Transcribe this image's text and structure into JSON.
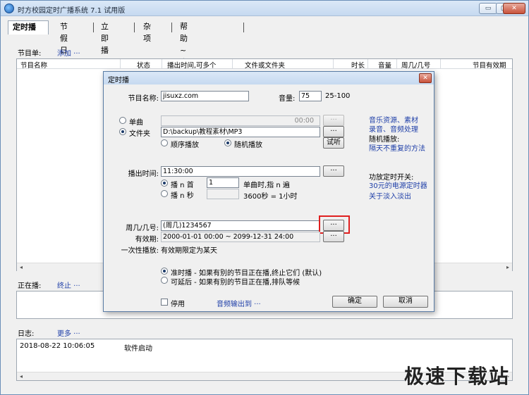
{
  "window": {
    "title": "时方校园定时广播系统 7.1 试用版",
    "controls": {
      "minimize": "▭",
      "maximize": "▢",
      "close": "✕"
    }
  },
  "tabs": [
    "定时播",
    "节假日",
    "立即播",
    "杂项",
    "帮助~咨询专家"
  ],
  "program_list": {
    "label": "节目单:",
    "add_link": "添加 ···",
    "columns": [
      "节目名称",
      "状态",
      "播出时间,可多个",
      "文件或文件夹",
      "时长",
      "音量",
      "周几/几号",
      "节目有效期"
    ]
  },
  "now_playing": {
    "label": "正在播:",
    "stop_link": "终止 ···"
  },
  "log": {
    "label": "日志:",
    "more_link": "更多 ···",
    "rows": [
      {
        "time": "2018-08-22 10:06:05",
        "event": "软件启动"
      }
    ]
  },
  "dialog": {
    "title": "定时播",
    "close": "✕",
    "program_name_label": "节目名称:",
    "program_name_value": "jisuxz.com",
    "volume_label": "音量:",
    "volume_value": "75",
    "volume_range": "25-100",
    "single_song_label": "单曲",
    "single_song_time": "00:00",
    "folder_label": "文件夹",
    "folder_value": "D:\\backup\\教程素材\\MP3",
    "sequential_label": "顺序播放",
    "random_label": "随机播放",
    "listen_button": "试听",
    "browse": "···",
    "air_time_label": "播出时间:",
    "air_time_value": "11:30:00",
    "play_n_songs_label": "播 n 首",
    "play_n_value": "1",
    "single_song_hint": "单曲时,指 n 遍",
    "play_n_seconds_label": "播 n 秒",
    "seconds_hint": "3600秒 = 1小时",
    "weekday_label": "周几/几号:",
    "weekday_value": "(周几)1234567",
    "validity_label": "有效期:",
    "validity_value": "2000-01-01 00:00 ~ 2099-12-31 24:00",
    "once_label": "一次性播放:",
    "once_value": "有效期限定为某天",
    "ontime_label": "准时播 - 如果有别的节目正在播,终止它们 (默认)",
    "delay_label": "可延后 - 如果有别的节目正在播,排队等候",
    "disable_label": "停用",
    "audio_output_link": "音频输出到 ···",
    "ok_button": "确定",
    "cancel_button": "取消",
    "side_links": {
      "music_resources": "音乐资源、素材",
      "recording": "录音、音频处理",
      "random_label": "随机播放:",
      "random_method": "隔天不重复的方法",
      "amp_label": "功放定时开关:",
      "power_timer": "30元的电源定时器",
      "fade": "关于淡入淡出"
    }
  },
  "watermark": "极速下载站",
  "colors": {
    "link": "#1f3fa8",
    "highlight": "#e02020"
  }
}
